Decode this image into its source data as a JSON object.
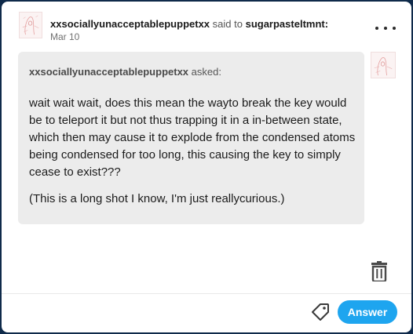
{
  "post": {
    "author": "xxsociallyunacceptablepuppetxx",
    "said_to_text": "said to",
    "recipient": "sugarpasteltmnt:",
    "date": "Mar 10",
    "more_icon": "more-horizontal-icon"
  },
  "ask": {
    "asker": "xxsociallyunacceptablepuppetxx",
    "asked_text": "asked:",
    "paragraphs": [
      "wait wait wait, does this mean the wayto break the key would be to teleport it but not thus trapping it in a in-between state, which then may cause it to explode from the condensed atoms being condensed for too long, this causing the key to simply cease to exist???",
      "(This is a long shot I know, I'm just reallycurious.)"
    ]
  },
  "actions": {
    "delete_icon": "trash-icon",
    "tag_icon": "tag-icon",
    "answer_label": "Answer",
    "answer_color": "#1ea5ef"
  },
  "colors": {
    "page_background": "#0f2a4a",
    "card_background": "#ffffff",
    "bubble_background": "#ececec"
  }
}
